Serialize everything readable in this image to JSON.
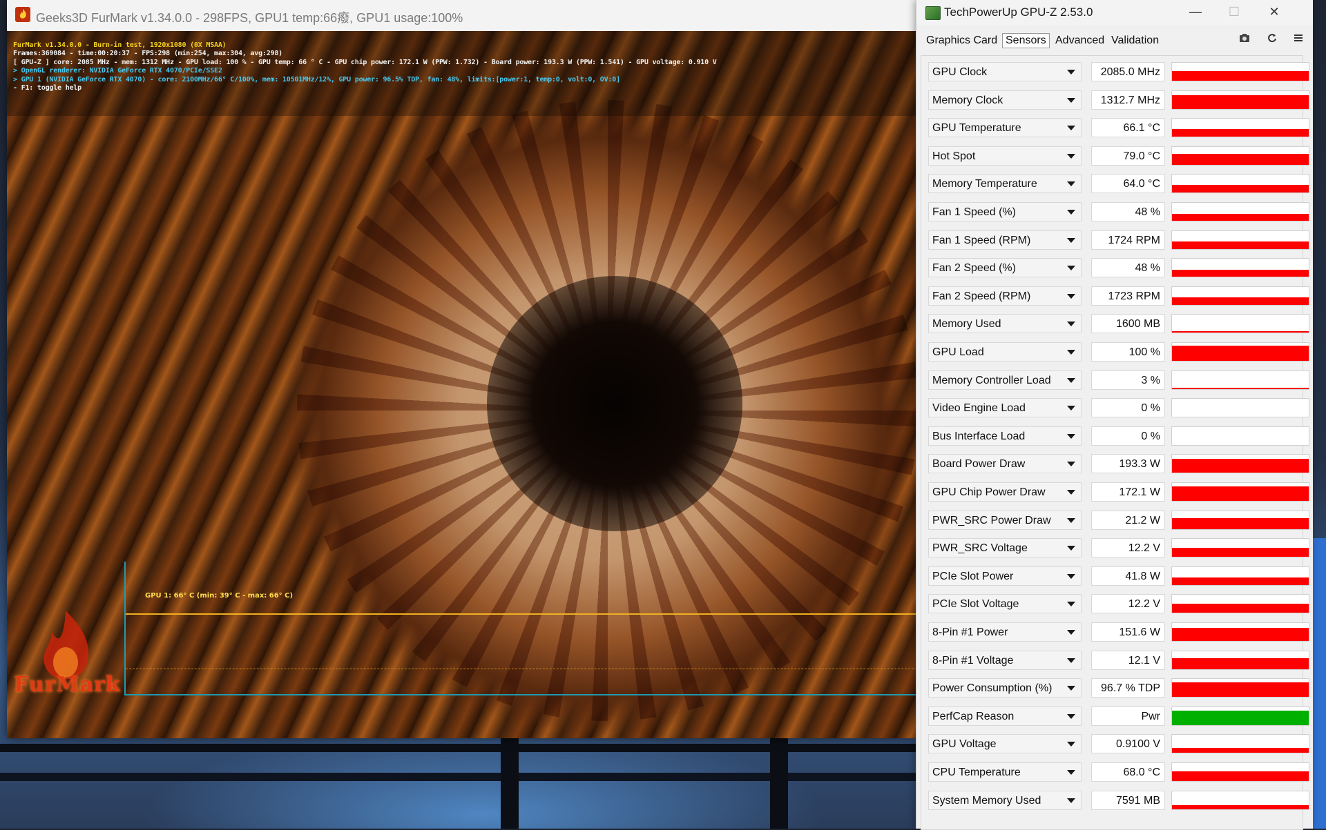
{
  "furmark": {
    "title": "Geeks3D FurMark v1.34.0.0 - 298FPS, GPU1 temp:66癈, GPU1 usage:100%",
    "hud": [
      {
        "text": "FurMark v1.34.0.0 - Burn-in test, 1920x1080 (0X MSAA)",
        "color": "yellow"
      },
      {
        "text": "Frames:369084 - time:00:20:37 - FPS:298 (min:254, max:304, avg:298)",
        "color": "white"
      },
      {
        "text": "[ GPU-Z ] core: 2085 MHz - mem: 1312 MHz - GPU load: 100 % - GPU temp: 66 ° C - GPU chip power: 172.1 W (PPW: 1.732) - Board power: 193.3 W (PPW: 1.541) - GPU voltage: 0.910 V",
        "color": "white"
      },
      {
        "text": "> OpenGL renderer: NVIDIA GeForce RTX 4070/PCIe/SSE2",
        "color": "cyan"
      },
      {
        "text": "> GPU 1 (NVIDIA GeForce RTX 4070) - core: 2100MHz/66° C/100%, mem: 10501MHz/12%, GPU power: 96.5% TDP, fan: 48%, limits:[power:1, temp:0, volt:0, OV:0]",
        "color": "cyan"
      },
      {
        "text": "- F1: toggle help",
        "color": "white"
      }
    ],
    "graph_label": "GPU 1: 66° C (min: 39° C - max: 66° C)",
    "logo_text": "FurMark"
  },
  "gpuz": {
    "title": "TechPowerUp GPU-Z 2.53.0",
    "tabs": [
      "Graphics Card",
      "Sensors",
      "Advanced",
      "Validation"
    ],
    "active_tab": "Sensors",
    "tools": {
      "screenshot": "camera-icon",
      "refresh": "refresh-icon",
      "menu": "menu-icon"
    },
    "colors": {
      "bar": "#ff0000",
      "bar_ok": "#00b000"
    },
    "sensors": [
      {
        "name": "GPU Clock",
        "value": "2085.0 MHz",
        "level": 0.55,
        "color": "#ff0000"
      },
      {
        "name": "Memory Clock",
        "value": "1312.7 MHz",
        "level": 0.75,
        "color": "#ff0000"
      },
      {
        "name": "GPU Temperature",
        "value": "66.1 °C",
        "level": 0.45,
        "color": "#ff0000"
      },
      {
        "name": "Hot Spot",
        "value": "79.0 °C",
        "level": 0.6,
        "color": "#ff0000"
      },
      {
        "name": "Memory Temperature",
        "value": "64.0 °C",
        "level": 0.42,
        "color": "#ff0000"
      },
      {
        "name": "Fan 1 Speed (%)",
        "value": "48 %",
        "level": 0.4,
        "color": "#ff0000"
      },
      {
        "name": "Fan 1 Speed (RPM)",
        "value": "1724 RPM",
        "level": 0.42,
        "color": "#ff0000"
      },
      {
        "name": "Fan 2 Speed (%)",
        "value": "48 %",
        "level": 0.4,
        "color": "#ff0000"
      },
      {
        "name": "Fan 2 Speed (RPM)",
        "value": "1723 RPM",
        "level": 0.42,
        "color": "#ff0000"
      },
      {
        "name": "Memory Used",
        "value": "1600 MB",
        "level": 0.1,
        "color": "#ff0000"
      },
      {
        "name": "GPU Load",
        "value": "100 %",
        "level": 0.85,
        "color": "#ff0000"
      },
      {
        "name": "Memory Controller Load",
        "value": "3 %",
        "level": 0.05,
        "color": "#ff0000"
      },
      {
        "name": "Video Engine Load",
        "value": "0 %",
        "level": 0,
        "color": "#ff0000"
      },
      {
        "name": "Bus Interface Load",
        "value": "0 %",
        "level": 0,
        "color": "#ff0000"
      },
      {
        "name": "Board Power Draw",
        "value": "193.3 W",
        "level": 0.8,
        "color": "#ff0000"
      },
      {
        "name": "GPU Chip Power Draw",
        "value": "172.1 W",
        "level": 0.8,
        "color": "#ff0000"
      },
      {
        "name": "PWR_SRC Power Draw",
        "value": "21.2 W",
        "level": 0.6,
        "color": "#ff0000"
      },
      {
        "name": "PWR_SRC Voltage",
        "value": "12.2 V",
        "level": 0.5,
        "color": "#ff0000"
      },
      {
        "name": "PCIe Slot Power",
        "value": "41.8 W",
        "level": 0.42,
        "color": "#ff0000"
      },
      {
        "name": "PCIe Slot Voltage",
        "value": "12.2 V",
        "level": 0.5,
        "color": "#ff0000"
      },
      {
        "name": "8-Pin #1 Power",
        "value": "151.6 W",
        "level": 0.75,
        "color": "#ff0000"
      },
      {
        "name": "8-Pin #1 Voltage",
        "value": "12.1 V",
        "level": 0.6,
        "color": "#ff0000"
      },
      {
        "name": "Power Consumption (%)",
        "value": "96.7 % TDP",
        "level": 0.8,
        "color": "#ff0000"
      },
      {
        "name": "PerfCap Reason",
        "value": "Pwr",
        "level": 0.8,
        "color": "#00b000"
      },
      {
        "name": "GPU Voltage",
        "value": "0.9100 V",
        "level": 0.3,
        "color": "#ff0000"
      },
      {
        "name": "CPU Temperature",
        "value": "68.0 °C",
        "level": 0.55,
        "color": "#ff0000"
      },
      {
        "name": "System Memory Used",
        "value": "7591 MB",
        "level": 0.22,
        "color": "#ff0000"
      }
    ]
  }
}
